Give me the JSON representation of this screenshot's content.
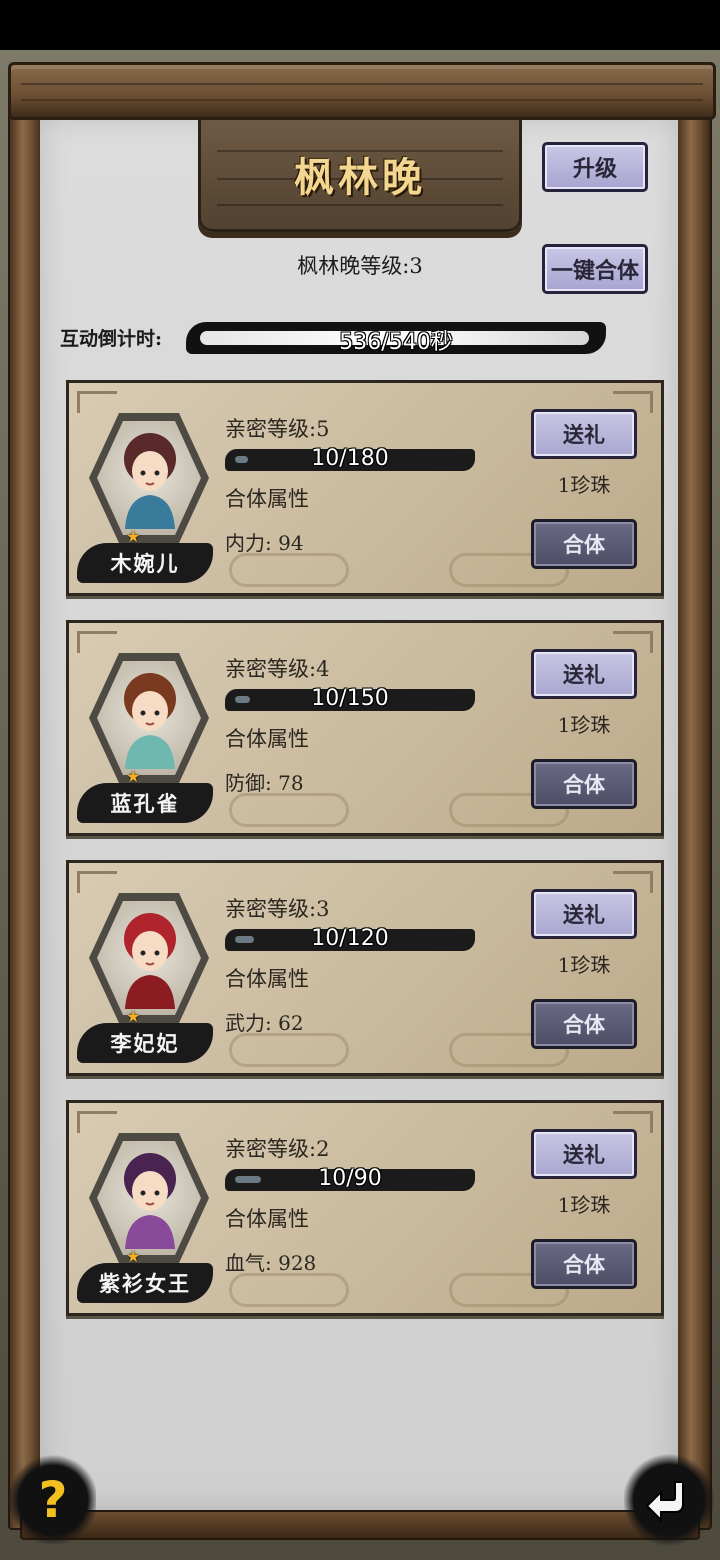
{
  "title": "枫林晚",
  "level_text": "枫林晚等级:3",
  "buttons": {
    "upgrade": "升级",
    "merge_all": "一键合体"
  },
  "countdown": {
    "label": "互动倒计时:",
    "value": "536/540秒",
    "progress": 0.9926
  },
  "characters": [
    {
      "name": "木婉儿",
      "affinity_level": "亲密等级:5",
      "affinity_progress": "10/180",
      "affinity_ratio": 0.056,
      "attr_header": "合体属性",
      "attr": "内力: 94",
      "gift_label": "送礼",
      "cost": "1珍珠",
      "merge_label": "合体",
      "stars": "★",
      "hair_color": "#5a2a2a",
      "outfit_color": "#3a7a9a"
    },
    {
      "name": "蓝孔雀",
      "affinity_level": "亲密等级:4",
      "affinity_progress": "10/150",
      "affinity_ratio": 0.067,
      "attr_header": "合体属性",
      "attr": "防御: 78",
      "gift_label": "送礼",
      "cost": "1珍珠",
      "merge_label": "合体",
      "stars": "★",
      "hair_color": "#7a3a20",
      "outfit_color": "#6fb8b0"
    },
    {
      "name": "李妃妃",
      "affinity_level": "亲密等级:3",
      "affinity_progress": "10/120",
      "affinity_ratio": 0.083,
      "attr_header": "合体属性",
      "attr": "武力: 62",
      "gift_label": "送礼",
      "cost": "1珍珠",
      "merge_label": "合体",
      "stars": "★",
      "hair_color": "#b0242e",
      "outfit_color": "#8a1c22"
    },
    {
      "name": "紫衫女王",
      "affinity_level": "亲密等级:2",
      "affinity_progress": "10/90",
      "affinity_ratio": 0.111,
      "attr_header": "合体属性",
      "attr": "血气: 928",
      "gift_label": "送礼",
      "cost": "1珍珠",
      "merge_label": "合体",
      "stars": "★",
      "hair_color": "#4a2450",
      "outfit_color": "#8a4a9a"
    }
  ],
  "help_label": "?",
  "icons": {
    "help": "question-icon",
    "back": "back-arrow-icon",
    "star": "star-icon"
  }
}
